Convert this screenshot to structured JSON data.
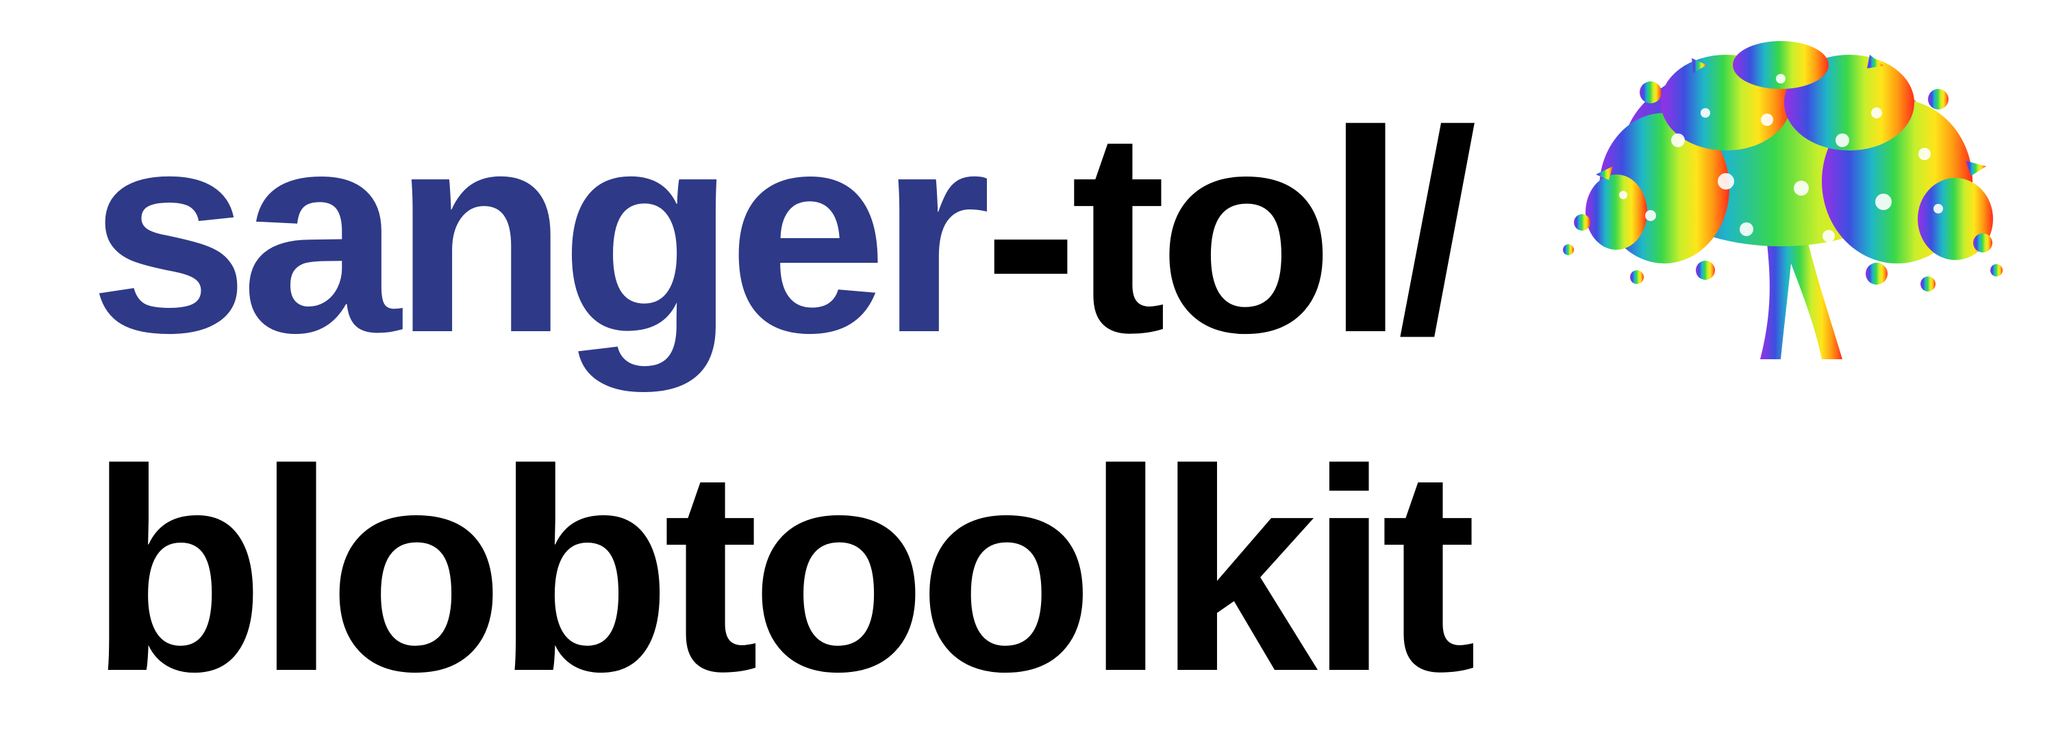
{
  "logo": {
    "line1": {
      "accent": "sanger",
      "rest": "-tol/"
    },
    "line2": "blobtoolkit",
    "colors": {
      "accent": "#2e3a87",
      "text": "#000000",
      "background": "#ffffff"
    },
    "emblem": {
      "icon": "tree-of-life-icon"
    }
  }
}
